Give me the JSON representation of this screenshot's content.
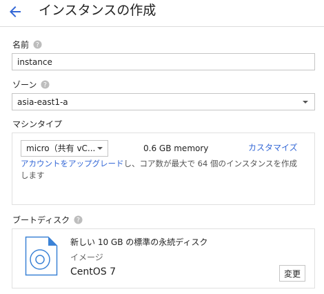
{
  "header": {
    "back_icon": "arrow-back-icon",
    "title": "インスタンスの作成"
  },
  "name": {
    "label": "名前",
    "value": "instance"
  },
  "zone": {
    "label": "ゾーン",
    "value": "asia-east1-a"
  },
  "machine_type": {
    "label": "マシンタイプ",
    "select_value": "micro（共有 vC...",
    "memory": "0.6 GB memory",
    "customize_link": "カスタマイズ",
    "upgrade_link": "アカウントをアップグレード",
    "upgrade_text": "し、コア数が最大で 64 個のインスタンスを作成します"
  },
  "boot_disk": {
    "label": "ブートディスク",
    "title": "新しい 10 GB の標準の永続ディスク",
    "type": "イメージ",
    "os": "CentOS 7",
    "change_button": "変更"
  },
  "colors": {
    "accent": "#3367d6",
    "border": "#c4c4c4",
    "help_icon": "#bdbdbd"
  },
  "icons": [
    "arrow-back-icon",
    "help-icon",
    "dropdown-caret-icon",
    "disk-icon"
  ]
}
